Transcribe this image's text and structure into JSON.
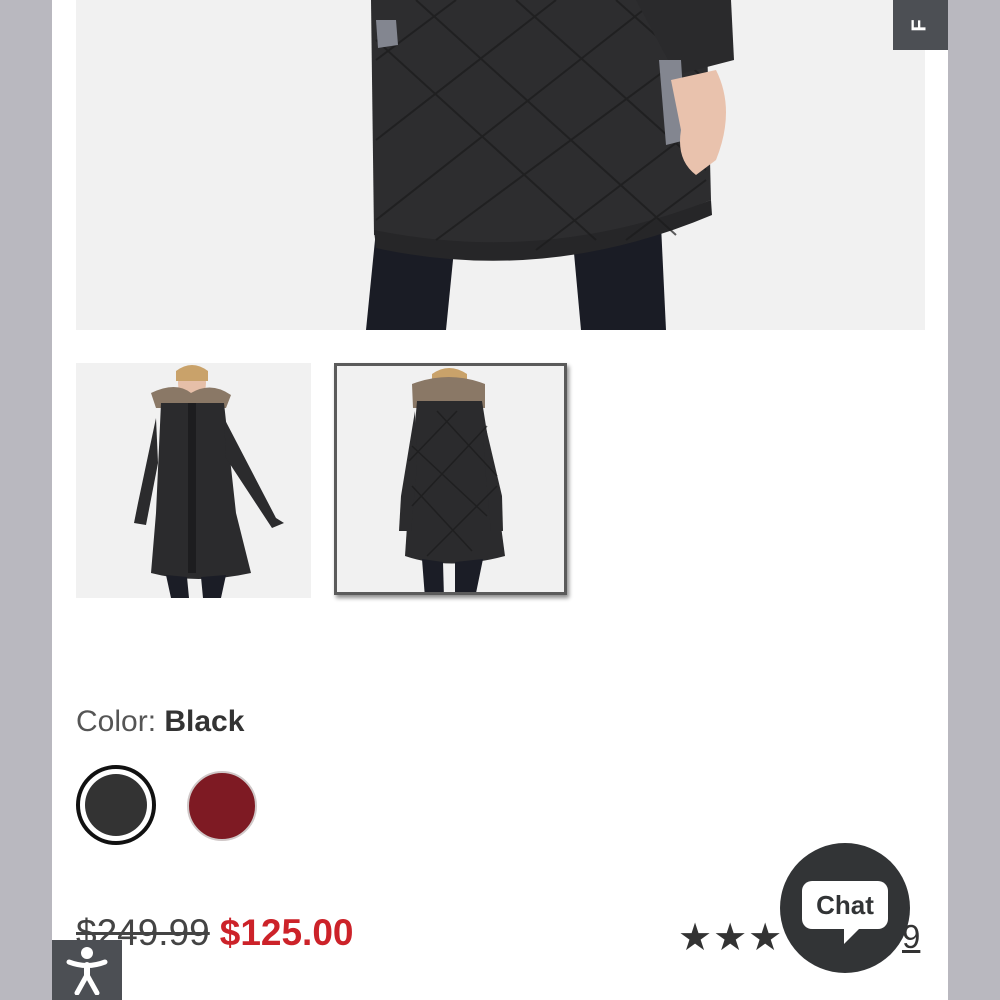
{
  "feedback_tab": {
    "label": "F"
  },
  "product": {
    "color_label": "Color:",
    "color_value": "Black",
    "swatches": [
      {
        "name": "Black",
        "hex": "#333333",
        "selected": true
      },
      {
        "name": "Red",
        "hex": "#7e1a23",
        "selected": false
      }
    ],
    "price_original": "$249.99",
    "price_sale": "$125.00",
    "rating_stars": "★★★",
    "review_count": "9"
  },
  "chat": {
    "label": "Chat"
  },
  "accessibility": {
    "icon": "accessibility-icon"
  },
  "colors": {
    "sale": "#cc2229",
    "dark_ui": "#4c4f54",
    "background": "#b9b8bf"
  }
}
